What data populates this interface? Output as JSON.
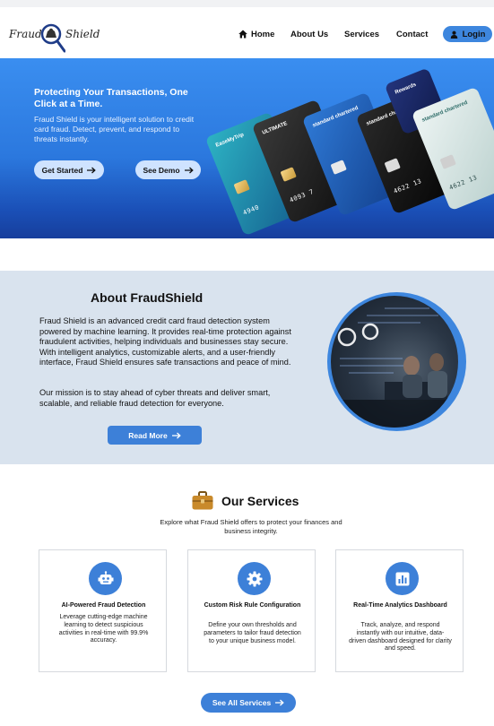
{
  "brand": {
    "name_part1": "Fraud",
    "name_part2": "Shield"
  },
  "nav": {
    "home": "Home",
    "about": "About Us",
    "services": "Services",
    "contact": "Contact",
    "login": "Login"
  },
  "hero": {
    "title": "Protecting Your Transactions, One Click at a Time.",
    "subtitle": "Fraud Shield is your intelligent solution to credit card fraud. Detect, prevent, and respond to threats instantly.",
    "btn_started": "Get Started",
    "btn_demo": "See Demo",
    "cards": [
      {
        "brand": "EaseMyTrip",
        "number": "4940",
        "color": "#1f8fa0"
      },
      {
        "brand": "ULTIMATE",
        "number": "4093 7",
        "color": "#2b2b2b"
      },
      {
        "brand": "standard chartered",
        "number": "",
        "color": "#1d5fb8"
      },
      {
        "brand": "standard chartered",
        "number": "4622 13",
        "color": "#161616"
      },
      {
        "brand": "Rewards",
        "number": "",
        "color": "#1a2a6c"
      },
      {
        "brand": "standard chartered",
        "number": "4622 13",
        "color": "#d8e6e4"
      }
    ]
  },
  "about": {
    "title": "About FraudShield",
    "p1": "Fraud Shield is an advanced credit card fraud detection system powered by machine learning. It provides real-time protection against fraudulent activities, helping individuals and businesses stay secure. With intelligent analytics, customizable alerts, and a user-friendly interface, Fraud Shield ensures safe transactions and peace of mind.",
    "p2": "Our mission is to stay ahead of cyber threats and deliver smart, scalable, and reliable fraud detection for everyone.",
    "btn_read": "Read More"
  },
  "services": {
    "title": "Our Services",
    "subtitle": "Explore what Fraud Shield offers to protect your finances and business integrity.",
    "items": [
      {
        "icon": "robot-icon",
        "title": "AI-Powered Fraud Detection",
        "desc": "Leverage cutting-edge machine learning to detect suspicious activities in real-time with 99.9% accuracy."
      },
      {
        "icon": "gear-icon",
        "title": "Custom Risk Rule Configuration",
        "desc": "Define your own thresholds and parameters to tailor fraud detection to your unique business model."
      },
      {
        "icon": "bar-chart-icon",
        "title": "Real-Time Analytics Dashboard",
        "desc": "Track, analyze, and respond instantly with our intuitive, data-driven dashboard designed for clarity and speed."
      }
    ],
    "btn_all": "See All Services"
  },
  "colors": {
    "accent": "#3d80d8",
    "hero_top": "#3a8ef0",
    "hero_bottom": "#173e9c",
    "about_bg": "#d9e3ee"
  }
}
